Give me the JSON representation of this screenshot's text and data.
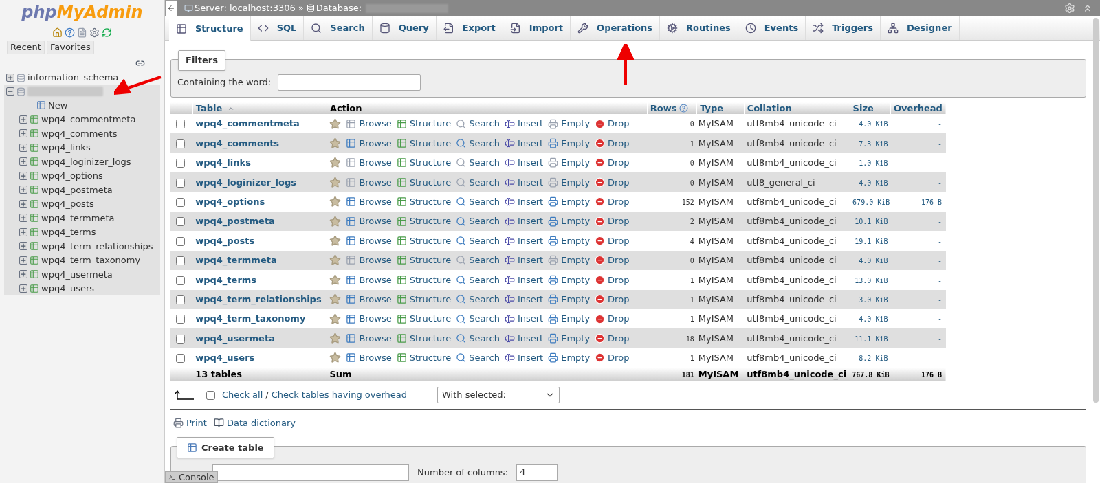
{
  "sidebar": {
    "logo": [
      "php",
      "MyAdmin"
    ],
    "buttons": [
      "Recent",
      "Favorites"
    ],
    "tree": [
      {
        "name": "information_schema",
        "redacted": false,
        "expanded": false
      },
      {
        "redacted": true,
        "expanded": true,
        "children": [
          {
            "kind": "new",
            "name": "New"
          },
          {
            "kind": "table",
            "name": "wpq4_commentmeta"
          },
          {
            "kind": "table",
            "name": "wpq4_comments"
          },
          {
            "kind": "table",
            "name": "wpq4_links"
          },
          {
            "kind": "table",
            "name": "wpq4_loginizer_logs"
          },
          {
            "kind": "table",
            "name": "wpq4_options"
          },
          {
            "kind": "table",
            "name": "wpq4_postmeta"
          },
          {
            "kind": "table",
            "name": "wpq4_posts"
          },
          {
            "kind": "table",
            "name": "wpq4_termmeta"
          },
          {
            "kind": "table",
            "name": "wpq4_terms"
          },
          {
            "kind": "table",
            "name": "wpq4_term_relationships"
          },
          {
            "kind": "table",
            "name": "wpq4_term_taxonomy"
          },
          {
            "kind": "table",
            "name": "wpq4_usermeta"
          },
          {
            "kind": "table",
            "name": "wpq4_users"
          }
        ]
      }
    ]
  },
  "breadcrumb": {
    "server": "Server: localhost:3306",
    "separator": "»",
    "database": "Database:",
    "database_redacted": true
  },
  "tabs": [
    {
      "kind": "structure",
      "label": "Structure",
      "selected": true
    },
    {
      "kind": "sql",
      "label": "SQL",
      "selected": false
    },
    {
      "kind": "search",
      "label": "Search",
      "selected": false
    },
    {
      "kind": "query",
      "label": "Query",
      "selected": false
    },
    {
      "kind": "export",
      "label": "Export",
      "selected": false
    },
    {
      "kind": "import",
      "label": "Import",
      "selected": false
    },
    {
      "kind": "operations",
      "label": "Operations",
      "selected": false
    },
    {
      "kind": "routines",
      "label": "Routines",
      "selected": false
    },
    {
      "kind": "events",
      "label": "Events",
      "selected": false
    },
    {
      "kind": "triggers",
      "label": "Triggers",
      "selected": false
    },
    {
      "kind": "designer",
      "label": "Designer",
      "selected": false
    }
  ],
  "filters": {
    "legend": "Filters",
    "label": "Containing the word:"
  },
  "table": {
    "columns": [
      "Table",
      "Action",
      "Rows",
      "Type",
      "Collation",
      "Size",
      "Overhead"
    ],
    "rows": [
      {
        "checked": false,
        "name": "wpq4_commentmeta",
        "empty": true,
        "actions": [
          "Browse",
          "Structure",
          "Search",
          "Insert",
          "Empty",
          "Drop"
        ],
        "rows": "0",
        "type": "MyISAM",
        "collation": "utf8mb4_unicode_ci",
        "size": "4.0 KiB",
        "overhead": "-"
      },
      {
        "checked": false,
        "name": "wpq4_comments",
        "empty": false,
        "actions": [
          "Browse",
          "Structure",
          "Search",
          "Insert",
          "Empty",
          "Drop"
        ],
        "rows": "1",
        "type": "MyISAM",
        "collation": "utf8mb4_unicode_ci",
        "size": "7.3 KiB",
        "overhead": "-"
      },
      {
        "checked": false,
        "name": "wpq4_links",
        "empty": true,
        "actions": [
          "Browse",
          "Structure",
          "Search",
          "Insert",
          "Empty",
          "Drop"
        ],
        "rows": "0",
        "type": "MyISAM",
        "collation": "utf8mb4_unicode_ci",
        "size": "1.0 KiB",
        "overhead": "-"
      },
      {
        "checked": false,
        "name": "wpq4_loginizer_logs",
        "empty": true,
        "actions": [
          "Browse",
          "Structure",
          "Search",
          "Insert",
          "Empty",
          "Drop"
        ],
        "rows": "0",
        "type": "MyISAM",
        "collation": "utf8_general_ci",
        "size": "4.0 KiB",
        "overhead": "-"
      },
      {
        "checked": false,
        "name": "wpq4_options",
        "empty": false,
        "actions": [
          "Browse",
          "Structure",
          "Search",
          "Insert",
          "Empty",
          "Drop"
        ],
        "rows": "152",
        "type": "MyISAM",
        "collation": "utf8mb4_unicode_ci",
        "size": "679.0 KiB",
        "overhead": "176 B"
      },
      {
        "checked": false,
        "name": "wpq4_postmeta",
        "empty": false,
        "actions": [
          "Browse",
          "Structure",
          "Search",
          "Insert",
          "Empty",
          "Drop"
        ],
        "rows": "2",
        "type": "MyISAM",
        "collation": "utf8mb4_unicode_ci",
        "size": "10.1 KiB",
        "overhead": "-"
      },
      {
        "checked": false,
        "name": "wpq4_posts",
        "empty": false,
        "actions": [
          "Browse",
          "Structure",
          "Search",
          "Insert",
          "Empty",
          "Drop"
        ],
        "rows": "4",
        "type": "MyISAM",
        "collation": "utf8mb4_unicode_ci",
        "size": "19.1 KiB",
        "overhead": "-"
      },
      {
        "checked": false,
        "name": "wpq4_termmeta",
        "empty": true,
        "actions": [
          "Browse",
          "Structure",
          "Search",
          "Insert",
          "Empty",
          "Drop"
        ],
        "rows": "0",
        "type": "MyISAM",
        "collation": "utf8mb4_unicode_ci",
        "size": "4.0 KiB",
        "overhead": "-"
      },
      {
        "checked": false,
        "name": "wpq4_terms",
        "empty": false,
        "actions": [
          "Browse",
          "Structure",
          "Search",
          "Insert",
          "Empty",
          "Drop"
        ],
        "rows": "1",
        "type": "MyISAM",
        "collation": "utf8mb4_unicode_ci",
        "size": "13.0 KiB",
        "overhead": "-"
      },
      {
        "checked": false,
        "name": "wpq4_term_relationships",
        "empty": false,
        "actions": [
          "Browse",
          "Structure",
          "Search",
          "Insert",
          "Empty",
          "Drop"
        ],
        "rows": "1",
        "type": "MyISAM",
        "collation": "utf8mb4_unicode_ci",
        "size": "3.0 KiB",
        "overhead": "-"
      },
      {
        "checked": false,
        "name": "wpq4_term_taxonomy",
        "empty": false,
        "actions": [
          "Browse",
          "Structure",
          "Search",
          "Insert",
          "Empty",
          "Drop"
        ],
        "rows": "1",
        "type": "MyISAM",
        "collation": "utf8mb4_unicode_ci",
        "size": "4.0 KiB",
        "overhead": "-"
      },
      {
        "checked": false,
        "name": "wpq4_usermeta",
        "empty": false,
        "actions": [
          "Browse",
          "Structure",
          "Search",
          "Insert",
          "Empty",
          "Drop"
        ],
        "rows": "18",
        "type": "MyISAM",
        "collation": "utf8mb4_unicode_ci",
        "size": "11.1 KiB",
        "overhead": "-"
      },
      {
        "checked": false,
        "name": "wpq4_users",
        "empty": false,
        "actions": [
          "Browse",
          "Structure",
          "Search",
          "Insert",
          "Empty",
          "Drop"
        ],
        "rows": "1",
        "type": "MyISAM",
        "collation": "utf8mb4_unicode_ci",
        "size": "8.2 KiB",
        "overhead": "-"
      }
    ],
    "footer": {
      "tables": "13 tables",
      "label": "Sum",
      "rows": "181",
      "type": "MyISAM",
      "collation": "utf8mb4_unicode_ci",
      "size": "767.8 KiB",
      "overhead": "176 B"
    }
  },
  "bulk": {
    "checked": false,
    "check_all": "Check all",
    "separator": "/",
    "check_overhead": "Check tables having overhead",
    "select": "With selected:"
  },
  "links": [
    "Print",
    "Data dictionary"
  ],
  "create_table": {
    "legend": "Create table",
    "columns_label": "Number of columns:",
    "columns_value": "4"
  },
  "console": "Console"
}
